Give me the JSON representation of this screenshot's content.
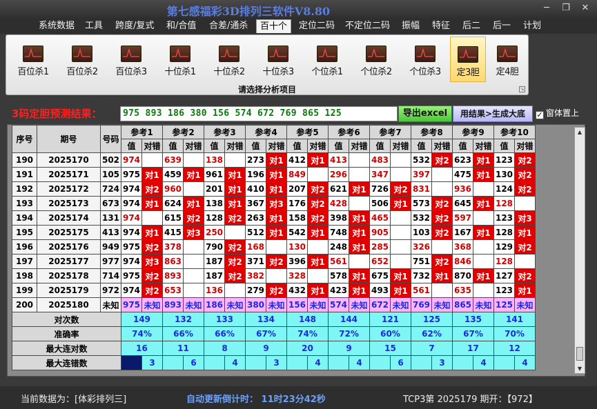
{
  "window": {
    "title": "第七感福彩3D排列三软件V8.80"
  },
  "menu": [
    "系统数据",
    "工具",
    "跨度/复式",
    "和/合值",
    "合差/通杀",
    "百十个",
    "定位二码",
    "不定位二码",
    "振幅",
    "特征",
    "后二",
    "后一",
    "计划"
  ],
  "menu_active": "百十个",
  "ribbon": {
    "buttons": [
      "百位杀1",
      "百位杀2",
      "百位杀3",
      "十位杀1",
      "十位杀2",
      "十位杀3",
      "个位杀1",
      "个位杀2",
      "个位杀3",
      "定3胆",
      "定4胆"
    ],
    "selected": "定3胆",
    "caption": "请选择分析项目"
  },
  "predict": {
    "label": "3码定胆预测结果：",
    "result": "975 893 186 380 156 574 672 769 865 125",
    "excel_button": "导出excel",
    "generate_button": "用结果>生成大底",
    "topmost_label": "窗体置上",
    "topmost_checked": true
  },
  "table": {
    "col_seq": "序号",
    "col_issue": "期号",
    "col_num": "号码",
    "refs": [
      "参考1",
      "参考2",
      "参考3",
      "参考4",
      "参考5",
      "参考6",
      "参考7",
      "参考8",
      "参考9",
      "参考10"
    ],
    "sub_value": "值",
    "sub_result": "对错",
    "hit_labels": {
      "1": "对1",
      "2": "对2",
      "3": "对3"
    },
    "rows": [
      {
        "seq": "190",
        "issue": "2025170",
        "num": "502",
        "cells": [
          [
            "974",
            "r",
            0
          ],
          [
            "639",
            "r",
            0
          ],
          [
            "138",
            "r",
            0
          ],
          [
            "273",
            "b",
            1
          ],
          [
            "412",
            "b",
            1
          ],
          [
            "413",
            "r",
            0
          ],
          [
            "483",
            "r",
            0
          ],
          [
            "532",
            "b",
            2
          ],
          [
            "623",
            "b",
            1
          ],
          [
            "123",
            "b",
            2
          ]
        ]
      },
      {
        "seq": "191",
        "issue": "2025171",
        "num": "105",
        "cells": [
          [
            "975",
            "b",
            1
          ],
          [
            "459",
            "b",
            1
          ],
          [
            "961",
            "b",
            1
          ],
          [
            "196",
            "b",
            1
          ],
          [
            "849",
            "r",
            0
          ],
          [
            "296",
            "r",
            0
          ],
          [
            "347",
            "r",
            0
          ],
          [
            "397",
            "r",
            0
          ],
          [
            "475",
            "b",
            1
          ],
          [
            "130",
            "b",
            2
          ]
        ]
      },
      {
        "seq": "192",
        "issue": "2025172",
        "num": "724",
        "cells": [
          [
            "974",
            "b",
            2
          ],
          [
            "960",
            "r",
            0
          ],
          [
            "201",
            "b",
            1
          ],
          [
            "410",
            "b",
            1
          ],
          [
            "207",
            "b",
            2
          ],
          [
            "621",
            "b",
            1
          ],
          [
            "726",
            "b",
            2
          ],
          [
            "831",
            "r",
            0
          ],
          [
            "936",
            "r",
            0
          ],
          [
            "124",
            "b",
            2
          ]
        ]
      },
      {
        "seq": "193",
        "issue": "2025173",
        "num": "673",
        "cells": [
          [
            "974",
            "b",
            1
          ],
          [
            "624",
            "b",
            1
          ],
          [
            "138",
            "b",
            1
          ],
          [
            "367",
            "b",
            3
          ],
          [
            "176",
            "b",
            2
          ],
          [
            "428",
            "r",
            0
          ],
          [
            "506",
            "b",
            1
          ],
          [
            "573",
            "b",
            2
          ],
          [
            "645",
            "b",
            1
          ],
          [
            "128",
            "r",
            0
          ]
        ]
      },
      {
        "seq": "194",
        "issue": "2025174",
        "num": "131",
        "cells": [
          [
            "974",
            "r",
            0
          ],
          [
            "615",
            "b",
            2
          ],
          [
            "128",
            "b",
            2
          ],
          [
            "263",
            "b",
            1
          ],
          [
            "158",
            "b",
            2
          ],
          [
            "398",
            "b",
            1
          ],
          [
            "465",
            "r",
            0
          ],
          [
            "532",
            "b",
            2
          ],
          [
            "597",
            "r",
            0
          ],
          [
            "123",
            "b",
            3
          ]
        ]
      },
      {
        "seq": "195",
        "issue": "2025175",
        "num": "413",
        "cells": [
          [
            "974",
            "b",
            1
          ],
          [
            "415",
            "b",
            3
          ],
          [
            "250",
            "r",
            0
          ],
          [
            "512",
            "b",
            1
          ],
          [
            "542",
            "b",
            1
          ],
          [
            "748",
            "b",
            1
          ],
          [
            "905",
            "r",
            0
          ],
          [
            "103",
            "b",
            2
          ],
          [
            "167",
            "b",
            1
          ],
          [
            "128",
            "b",
            1
          ]
        ]
      },
      {
        "seq": "196",
        "issue": "2025176",
        "num": "949",
        "cells": [
          [
            "975",
            "b",
            2
          ],
          [
            "378",
            "r",
            0
          ],
          [
            "790",
            "b",
            2
          ],
          [
            "168",
            "r",
            0
          ],
          [
            "130",
            "r",
            0
          ],
          [
            "248",
            "b",
            1
          ],
          [
            "285",
            "r",
            0
          ],
          [
            "326",
            "r",
            0
          ],
          [
            "368",
            "r",
            0
          ],
          [
            "129",
            "b",
            2
          ]
        ]
      },
      {
        "seq": "197",
        "issue": "2025177",
        "num": "977",
        "cells": [
          [
            "974",
            "b",
            3
          ],
          [
            "863",
            "r",
            0
          ],
          [
            "187",
            "b",
            2
          ],
          [
            "371",
            "b",
            2
          ],
          [
            "396",
            "b",
            1
          ],
          [
            "561",
            "r",
            0
          ],
          [
            "652",
            "r",
            0
          ],
          [
            "751",
            "b",
            2
          ],
          [
            "846",
            "r",
            0
          ],
          [
            "128",
            "r",
            0
          ]
        ]
      },
      {
        "seq": "198",
        "issue": "2025178",
        "num": "714",
        "cells": [
          [
            "975",
            "b",
            2
          ],
          [
            "893",
            "r",
            0
          ],
          [
            "187",
            "b",
            2
          ],
          [
            "382",
            "r",
            0
          ],
          [
            "328",
            "r",
            0
          ],
          [
            "578",
            "b",
            1
          ],
          [
            "675",
            "b",
            1
          ],
          [
            "732",
            "b",
            1
          ],
          [
            "870",
            "b",
            1
          ],
          [
            "127",
            "b",
            2
          ]
        ]
      },
      {
        "seq": "199",
        "issue": "2025179",
        "num": "972",
        "cells": [
          [
            "974",
            "b",
            2
          ],
          [
            "653",
            "r",
            0
          ],
          [
            "136",
            "r",
            0
          ],
          [
            "279",
            "b",
            2
          ],
          [
            "432",
            "b",
            1
          ],
          [
            "423",
            "b",
            1
          ],
          [
            "493",
            "b",
            1
          ],
          [
            "561",
            "r",
            0
          ],
          [
            "635",
            "r",
            0
          ],
          [
            "123",
            "b",
            1
          ]
        ]
      }
    ],
    "future_row": {
      "seq": "200",
      "issue": "2025180",
      "num": "未知",
      "values": [
        "975",
        "893",
        "186",
        "380",
        "156",
        "574",
        "672",
        "769",
        "865",
        "125"
      ],
      "result": "未知"
    },
    "stats": [
      {
        "label": "对次数",
        "values": [
          "149",
          "132",
          "133",
          "134",
          "148",
          "144",
          "121",
          "125",
          "135",
          "141"
        ]
      },
      {
        "label": "准确率",
        "values": [
          "74%",
          "66%",
          "66%",
          "67%",
          "74%",
          "72%",
          "60%",
          "62%",
          "67%",
          "70%"
        ]
      },
      {
        "label": "最大连对数",
        "values": [
          "16",
          "11",
          "8",
          "9",
          "20",
          "9",
          "15",
          "7",
          "17",
          "12"
        ]
      },
      {
        "label": "最大连错数",
        "values": [
          "3",
          "6",
          "4",
          "3",
          "4",
          "4",
          "6",
          "3",
          "4",
          "4"
        ]
      }
    ]
  },
  "status": {
    "source": "当前数据为：[体彩排列三]",
    "countdown": "自动更新倒计时：  11时23分42秒",
    "issue": "TCP3第 2025179 期开：【972】"
  },
  "colors": {
    "hit": "#e00000",
    "stats_bg": "#7ff6f6",
    "future_bg": "#ffb4ff",
    "stats_text": "#1a2ad8",
    "miss_text": "#d00000"
  }
}
